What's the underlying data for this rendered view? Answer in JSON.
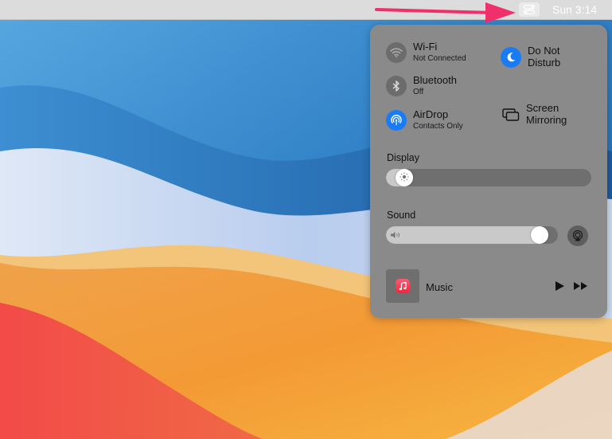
{
  "menubar": {
    "clock": "Sun 3:14",
    "icons": [
      "control-center-icon"
    ]
  },
  "control_center": {
    "wifi": {
      "title": "Wi-Fi",
      "status": "Not Connected"
    },
    "bluetooth": {
      "title": "Bluetooth",
      "status": "Off"
    },
    "airdrop": {
      "title": "AirDrop",
      "status": "Contacts Only"
    },
    "do_not_disturb": {
      "title": "Do Not\nDisturb",
      "line1": "Do Not",
      "line2": "Disturb"
    },
    "screen_mirroring": {
      "line1": "Screen",
      "line2": "Mirroring"
    },
    "display": {
      "label": "Display",
      "brightness": 0.05
    },
    "sound": {
      "label": "Sound",
      "volume": 0.94
    },
    "now_playing": {
      "app": "Music"
    }
  },
  "colors": {
    "accent_blue": "#1a7cf5",
    "annotation_arrow": "#f0306a",
    "panel": "#8a8a8a"
  }
}
